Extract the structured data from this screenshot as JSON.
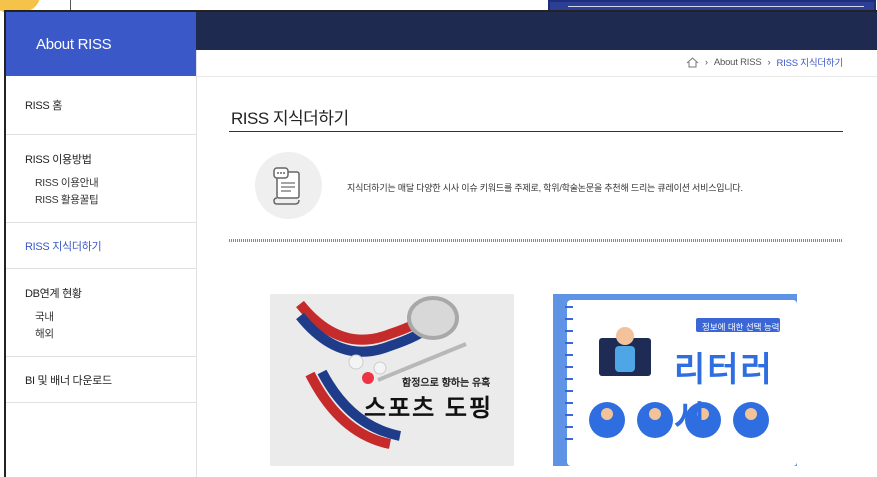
{
  "sidebar": {
    "title": "About RISS",
    "items": [
      {
        "label": "RISS 홈"
      },
      {
        "label": "RISS 이용방법",
        "subs": [
          "RISS 이용안내",
          "RISS 활용꿀팁"
        ]
      },
      {
        "label": "RISS 지식더하기"
      },
      {
        "label": "DB연계 현황",
        "subs": [
          "국내",
          "해외"
        ]
      },
      {
        "label": "BI 및 배너 다운로드"
      }
    ]
  },
  "breadcrumb": {
    "home_icon": "home-icon",
    "items": [
      "About RISS",
      "RISS 지식더하기"
    ]
  },
  "page": {
    "title": "RISS 지식더하기",
    "intro": "지식더하기는 매달 다양한 시사 이슈 키워드를 주제로, 학위/학술논문을 추천해 드리는 큐레이션 서비스입니다."
  },
  "cards": [
    {
      "caption": "함정으로 향하는 유혹",
      "title": "스포츠 도핑"
    },
    {
      "caption": "정보에 대한 선택 능력",
      "title": "리터러시"
    }
  ],
  "colors": {
    "accent": "#3a58c7",
    "header": "#1e2a4f"
  }
}
